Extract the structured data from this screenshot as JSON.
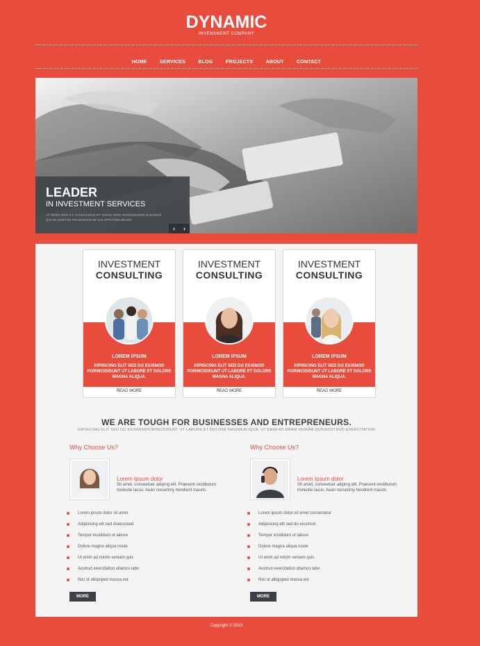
{
  "header": {
    "logo_title": "DYNAMIC",
    "logo_sub": "INVENSMENT COMPANY"
  },
  "nav": {
    "items": [
      "HOME",
      "SERVICES",
      "BLOG",
      "PROJECTS",
      "ABOUT",
      "CONTACT"
    ]
  },
  "slider": {
    "title": "LEADER",
    "subtitle": "IN INVESTMENT SERVICES",
    "text_line1": "AT VERO EOS ET ACCUSAMUS ET IUSTO ODIO DIGNISSIMOS DUCIMUS",
    "text_line2": "QUI BLANDITIIS PRAESENTIUM VOLUPTATUM DELEN",
    "prev": "‹",
    "next": "›"
  },
  "cards": [
    {
      "title1": "INVESTMENT",
      "title2": "CONSULTING",
      "label": "LOREM IPSUM",
      "desc": "DIPISICING ELIT SED DO EIUSMOD PORINCIDIDUNT UT LABORE ET DOLORE MAGNA ALIQUA.",
      "more": "READ MORE"
    },
    {
      "title1": "INVESTMENT",
      "title2": "CONSULTING",
      "label": "LOREM IPSUM",
      "desc": "DIPISICING ELIT SED DO EIUSMOD PORINCIDIDUNT UT LABORE ET DOLORE MAGNA ALIQUA.",
      "more": "READ MORE"
    },
    {
      "title1": "INVESTMENT",
      "title2": "CONSULTING",
      "label": "LOREM IPSUM",
      "desc": "DIPISICING ELIT SED DO EIUSMOD PORINCIDIDUNT UT LABORE ET DOLORE MAGNA ALIQUA.",
      "more": "READ MORE"
    }
  ],
  "tough": {
    "heading": "WE ARE TOUGH FOR BUSINESSES AND ENTREPRENEURS.",
    "sub": "DIPISICING ELIT SED DO EIUSMODPORINCIDIDUNT UT LABORE ET DOLORE MAGNA ALIQUA. UT ENIM AD MINIM VENIAM QUISNOSTRUD EXERCITATION"
  },
  "why": [
    {
      "heading": "Why Choose Us?",
      "person_title": "Lorem Ipsum dolor",
      "person_text": "Sit amet, conseetuer adiping elit. Praesent vestibulum molestie lacus. Aean nonummy hendrerit mauris.",
      "list": [
        "Lorem ipsum dolor sit amet",
        "Adipisicing elit sed doeiusmod",
        "Tempor incididunt ut labore",
        "Dolore magna aliqua noste",
        "Ut enim ad minim veniam quis",
        "Aostrud exercitation ullamco labo",
        "Nisi ut alliquiped massa est"
      ],
      "more": "MORE"
    },
    {
      "heading": "Why Choose Us?",
      "person_title": "Lorem Ipsum dolor",
      "person_text": "Sit amet, conseetuer adiping elit. Praesent vestibulum molestie lacus. Aean nonummy hendrerit mauris.",
      "list": [
        "Lorem ipsum dolor sit amet consectetur",
        "Adipisicing elit sed do eiusmod",
        "Tempor incididunt ut labore",
        "Dolore magna aliqua noste",
        "Ut enim ad minim veniam quis",
        "Aostrud exercitation ullamco labo",
        "Nisi ut alliquiped massa est"
      ],
      "more": "MORE"
    }
  ],
  "footer": {
    "copyright": "Copyright © 2013"
  },
  "colors": {
    "accent": "#e84c3d",
    "dark": "#3c4046",
    "panel": "#f4f4f4"
  }
}
